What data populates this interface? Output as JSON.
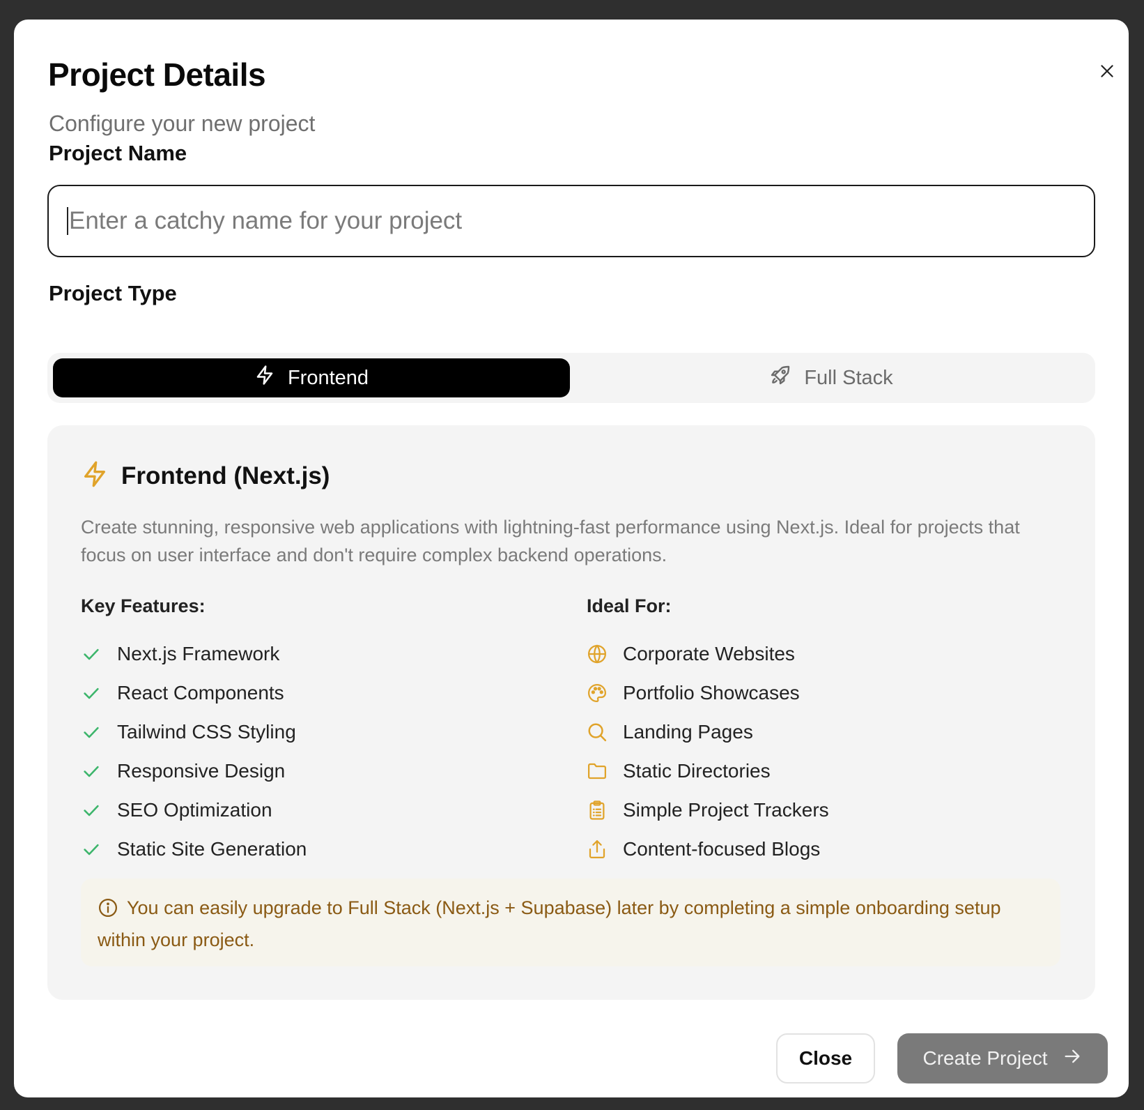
{
  "dialog": {
    "title": "Project Details",
    "subtitle": "Configure your new project",
    "close_icon": "close-icon"
  },
  "project_name": {
    "label": "Project Name",
    "value": "",
    "placeholder": "Enter a catchy name for your project"
  },
  "project_type": {
    "label": "Project Type",
    "options": [
      {
        "label": "Frontend",
        "icon": "lightning-icon",
        "selected": true
      },
      {
        "label": "Full Stack",
        "icon": "rocket-icon",
        "selected": false
      }
    ]
  },
  "details": {
    "title": "Frontend (Next.js)",
    "icon": "lightning-icon",
    "description": "Create stunning, responsive web applications with lightning-fast performance using Next.js. Ideal for projects that focus on user interface and don't require complex backend operations.",
    "key_features_title": "Key Features:",
    "key_features": [
      "Next.js Framework",
      "React Components",
      "Tailwind CSS Styling",
      "Responsive Design",
      "SEO Optimization",
      "Static Site Generation"
    ],
    "ideal_for_title": "Ideal For:",
    "ideal_for": [
      {
        "label": "Corporate Websites",
        "icon": "globe-icon"
      },
      {
        "label": "Portfolio Showcases",
        "icon": "palette-icon"
      },
      {
        "label": "Landing Pages",
        "icon": "search-icon"
      },
      {
        "label": "Static Directories",
        "icon": "folder-icon"
      },
      {
        "label": "Simple Project Trackers",
        "icon": "clipboard-icon"
      },
      {
        "label": "Content-focused Blogs",
        "icon": "share-icon"
      }
    ],
    "notice": "You can easily upgrade to Full Stack (Next.js + Supabase) later by completing a simple onboarding setup within your project."
  },
  "footer": {
    "close_label": "Close",
    "create_label": "Create Project"
  },
  "colors": {
    "accent": "#e0a32a",
    "check": "#3cb56b",
    "notice_text": "#8a5a14"
  }
}
